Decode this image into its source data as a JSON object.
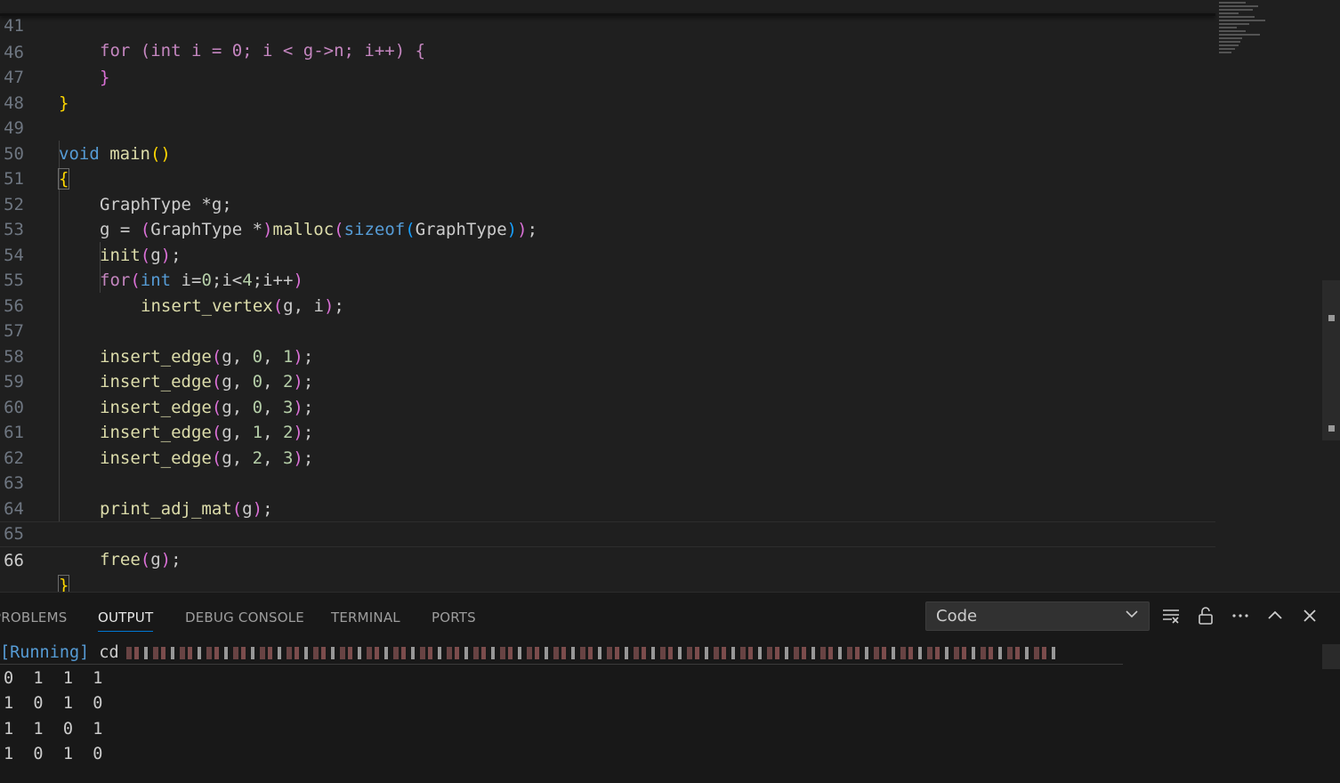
{
  "editor": {
    "lines": [
      {
        "n": "41",
        "cur": false
      },
      {
        "n": "46",
        "cur": false
      },
      {
        "n": "47",
        "cur": false
      },
      {
        "n": "48",
        "cur": false
      },
      {
        "n": "49",
        "cur": false
      },
      {
        "n": "50",
        "cur": false
      },
      {
        "n": "51",
        "cur": false
      },
      {
        "n": "52",
        "cur": false
      },
      {
        "n": "53",
        "cur": false
      },
      {
        "n": "54",
        "cur": false
      },
      {
        "n": "55",
        "cur": false
      },
      {
        "n": "56",
        "cur": false
      },
      {
        "n": "57",
        "cur": false
      },
      {
        "n": "58",
        "cur": false
      },
      {
        "n": "59",
        "cur": false
      },
      {
        "n": "60",
        "cur": false
      },
      {
        "n": "61",
        "cur": false
      },
      {
        "n": "62",
        "cur": false
      },
      {
        "n": "63",
        "cur": false
      },
      {
        "n": "64",
        "cur": false
      },
      {
        "n": "65",
        "cur": false
      },
      {
        "n": "66",
        "cur": true
      }
    ],
    "code": {
      "l41": "for (int i = 0; i < g->n; i++) {",
      "l46": "}",
      "l47": "}",
      "void": "void",
      "main": "main",
      "graphtype": "GraphType",
      "malloc": "malloc",
      "sizeof": "sizeof",
      "init": "init",
      "for": "for",
      "int": "int",
      "insert_vertex": "insert_vertex",
      "insert_edge": "insert_edge",
      "print_adj_mat": "print_adj_mat",
      "free": "free",
      "edges": [
        [
          "0",
          "1"
        ],
        [
          "0",
          "2"
        ],
        [
          "0",
          "3"
        ],
        [
          "1",
          "2"
        ],
        [
          "2",
          "3"
        ]
      ]
    }
  },
  "panel": {
    "tabs": [
      "PROBLEMS",
      "OUTPUT",
      "DEBUG CONSOLE",
      "TERMINAL",
      "PORTS"
    ],
    "active_tab": "OUTPUT",
    "channel": "Code",
    "running_label": "[Running]",
    "command_prefix": "cd",
    "output_rows": [
      "0  1  1  1",
      "1  0  1  0",
      "1  1  0  1",
      "1  0  1  0"
    ],
    "icons": [
      "clear-output-icon",
      "lock-scroll-icon",
      "more-actions-icon",
      "maximize-panel-icon",
      "close-panel-icon"
    ]
  }
}
